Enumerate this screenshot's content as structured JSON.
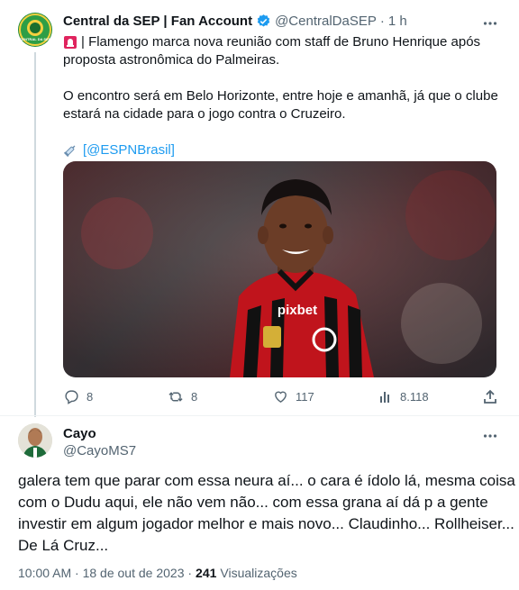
{
  "tweet": {
    "author_name": "Central da SEP | Fan Account",
    "handle": "@CentralDaSEP",
    "separator": "·",
    "time": "1 h",
    "line1": "| Flamengo marca nova reunião com staff de Bruno Henrique após",
    "line2": "proposta astronômica do Palmeiras.",
    "line3": "O encontro será em Belo Horizonte, entre hoje e amanhã, já que o clube",
    "line4": "estará na cidade para o jogo contra o Cruzeiro.",
    "source_open": "[",
    "source_link": "@ESPNBrasil",
    "source_close": "]",
    "avatar_text": "CENTRAL DA SEP",
    "photo": {
      "jersey_sponsor": "pixbet"
    },
    "actions": {
      "replies": "8",
      "retweets": "8",
      "likes": "117",
      "views": "8.118"
    }
  },
  "reply": {
    "author_name": "Cayo",
    "handle": "@CayoMS7",
    "text_lines": [
      "galera tem que parar com essa neura aí... o cara é ídolo lá, mesma coisa",
      "com o Dudu aqui, ele não vem não... com essa grana aí dá p a gente",
      "investir em algum jogador melhor e mais novo... Claudinho... Rollheiser...",
      "De Lá Cruz..."
    ],
    "timestamp": "10:00 AM · 18 de out de 2023 ·",
    "views_count": "241",
    "views_label": "Visualizações"
  },
  "colors": {
    "accent": "#1d9bf0",
    "verified": "#1d9bf0",
    "siren": "#e0245e",
    "gray": "#536471",
    "thread_line": "#cfd9de"
  }
}
